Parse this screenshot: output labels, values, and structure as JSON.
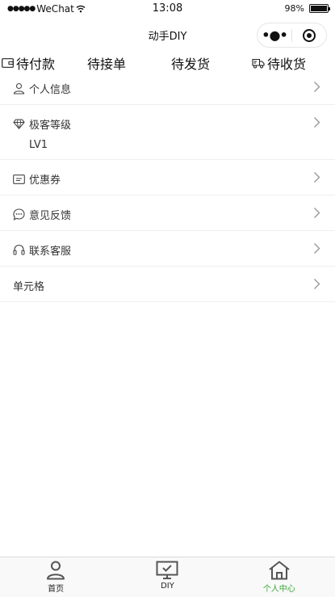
{
  "status_bar": {
    "carrier": "WeChat",
    "time": "13:08",
    "battery": "98%",
    "battery_level": 0.98
  },
  "nav": {
    "title": "动手DIY"
  },
  "order_tabs": [
    {
      "label": "待付款",
      "icon": "wallet-icon"
    },
    {
      "label": "待接单",
      "icon": ""
    },
    {
      "label": "待发货",
      "icon": ""
    },
    {
      "label": "待收货",
      "icon": "truck-icon"
    }
  ],
  "menu": [
    {
      "label": "个人信息",
      "icon": "user-icon"
    },
    {
      "label": "极客等级",
      "icon": "diamond-icon",
      "value": "LV1"
    },
    {
      "label": "优惠券",
      "icon": "coupon-icon"
    },
    {
      "label": "意见反馈",
      "icon": "chat-bubble-icon"
    },
    {
      "label": "联系客服",
      "icon": "headset-icon"
    },
    {
      "label": "单元格",
      "icon": ""
    }
  ],
  "tab_bar": {
    "items": [
      {
        "label": "首页",
        "icon": "person-icon",
        "active": false
      },
      {
        "label": "DIY",
        "icon": "monitor-check-icon",
        "active": false
      },
      {
        "label": "个人中心",
        "icon": "house-icon",
        "active": true
      }
    ],
    "active_color": "#3aa83a"
  }
}
